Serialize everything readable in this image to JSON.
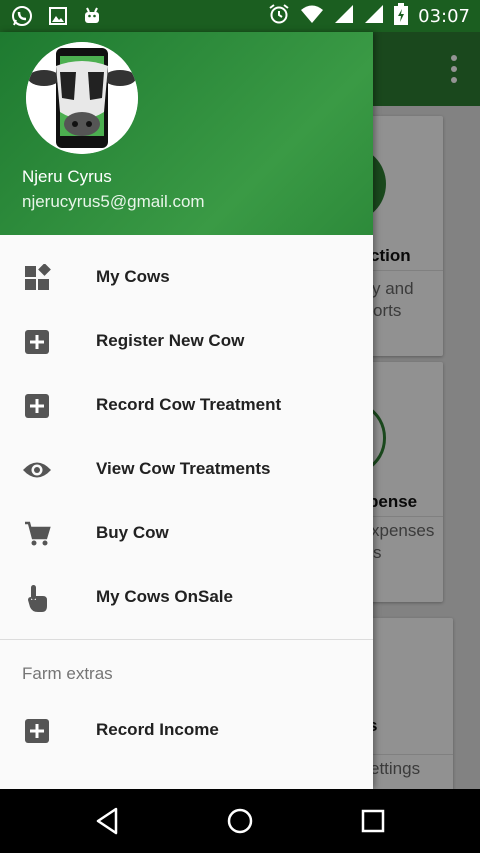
{
  "status_bar": {
    "time": "03:07",
    "left_icons": [
      "whatsapp-icon",
      "image-icon",
      "android-icon"
    ],
    "right_icons": [
      "alarm-icon",
      "wifi-icon",
      "signal-icon",
      "signal-icon",
      "battery-icon"
    ]
  },
  "drawer": {
    "header": {
      "user_name": "Njeru Cyrus",
      "user_email": "njerucyrus5@gmail.com"
    },
    "items": [
      {
        "label": "My Cows",
        "icon": "dashboard-icon"
      },
      {
        "label": "Register New Cow",
        "icon": "add-box-icon"
      },
      {
        "label": "Record Cow Treatment",
        "icon": "add-box-icon"
      },
      {
        "label": "View Cow Treatments",
        "icon": "eye-icon"
      },
      {
        "label": "Buy Cow",
        "icon": "cart-icon"
      },
      {
        "label": "My Cows OnSale",
        "icon": "touch-icon"
      }
    ],
    "section_title": "Farm extras",
    "extras": [
      {
        "label": "Record Income",
        "icon": "add-box-icon"
      }
    ]
  },
  "background_app": {
    "cards": [
      {
        "title": "ction",
        "subtitle_lines": [
          "y and",
          "orts"
        ]
      },
      {
        "title": "pense",
        "subtitle_lines": [
          "xpenses",
          "s"
        ]
      },
      {
        "title": "s",
        "subtitle_lines": [
          "ettings"
        ]
      }
    ]
  },
  "colors": {
    "primary": "#2e7d32",
    "primary_dark": "#1b5e20",
    "drawer_bg": "#fafafa"
  }
}
